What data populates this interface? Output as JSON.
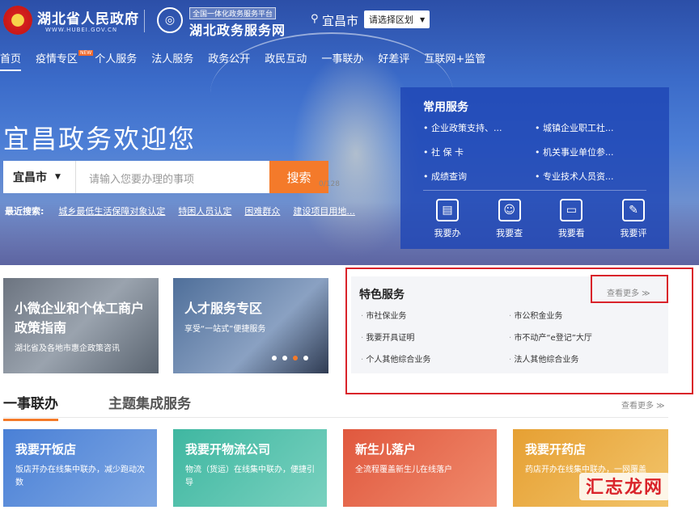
{
  "header": {
    "gov_name": "湖北省人民政府",
    "gov_url": "WWW.HUBEI.GOV.CN",
    "platform_tag": "全国一体化政务服务平台",
    "platform_name": "湖北政务服务网",
    "location": "宜昌市",
    "region_select": "请选择区划"
  },
  "nav": {
    "items": [
      "首页",
      "疫情专区",
      "个人服务",
      "法人服务",
      "政务公开",
      "政民互动",
      "一事联办",
      "好差评",
      "互联网+监管"
    ],
    "badge": "NEW"
  },
  "hero": {
    "welcome": "宜昌政务欢迎您",
    "search_city": "宜昌市",
    "search_placeholder": "请输入您要办理的事项",
    "search_count": "0/128",
    "search_button": "搜索",
    "hot_label": "最近搜索:",
    "hot_links": [
      "城乡最低生活保障对象认定",
      "特困人员认定",
      "困难群众",
      "建设项目用地..."
    ]
  },
  "common_services": {
    "title": "常用服务",
    "links": [
      "企业政策支持、...",
      "城镇企业职工社...",
      "社 保 卡",
      "机关事业单位参...",
      "成绩查询",
      "专业技术人员资..."
    ],
    "quick": [
      {
        "label": "我要办",
        "icon": "document-icon"
      },
      {
        "label": "我要查",
        "icon": "person-search-icon"
      },
      {
        "label": "我要看",
        "icon": "screen-icon"
      },
      {
        "label": "我要评",
        "icon": "comment-icon"
      }
    ]
  },
  "cards": [
    {
      "title": "小微企业和个体工商户政策指南",
      "sub": "湖北省及各地市惠企政策咨讯"
    },
    {
      "title": "人才服务专区",
      "sub": "享受“一站式”便捷服务"
    }
  ],
  "special": {
    "title": "特色服务",
    "more": "查看更多 ≫",
    "links": [
      "市社保业务",
      "市公积金业务",
      "我要开具证明",
      "市不动产“e登记”大厅",
      "个人其他综合业务",
      "法人其他综合业务"
    ]
  },
  "tabs": {
    "items": [
      "一事联办",
      "主题集成服务"
    ],
    "more": "查看更多 ≫"
  },
  "tiles": [
    {
      "title": "我要开饭店",
      "desc": "饭店开办在线集中联办，减少跑动次数"
    },
    {
      "title": "我要开物流公司",
      "desc": "物流（货运）在线集中联办，便捷引导"
    },
    {
      "title": "新生儿落户",
      "desc": "全流程覆盖新生儿在线落户"
    },
    {
      "title": "我要开药店",
      "desc": "药店开办在线集中联办，一网覆盖"
    }
  ],
  "watermark": "汇志龙网",
  "colors": {
    "accent": "#f47a2a",
    "highlight": "#d9232a",
    "common_bg": "#1e46b4"
  }
}
